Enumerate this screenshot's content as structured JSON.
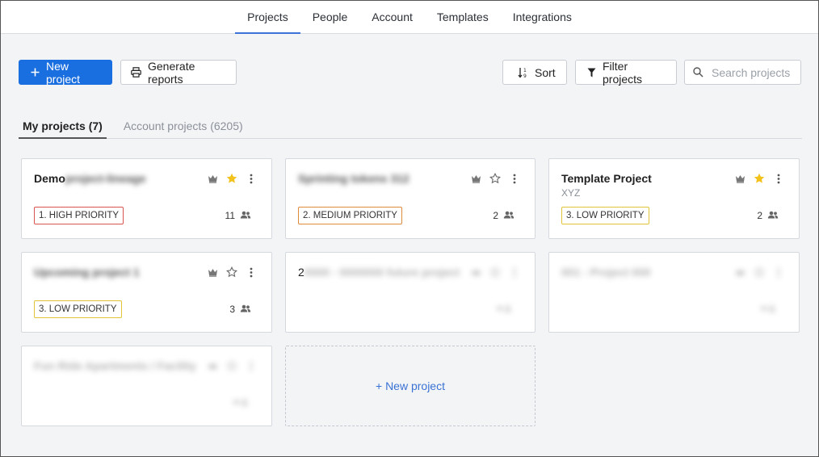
{
  "nav": {
    "items": [
      {
        "label": "Projects",
        "active": true
      },
      {
        "label": "People",
        "active": false
      },
      {
        "label": "Account",
        "active": false
      },
      {
        "label": "Templates",
        "active": false
      },
      {
        "label": "Integrations",
        "active": false
      }
    ]
  },
  "toolbar": {
    "new_project_label": "New project",
    "generate_reports_label": "Generate reports",
    "sort_label": "Sort",
    "filter_label": "Filter projects",
    "search_placeholder": "Search projects"
  },
  "tabs": {
    "my_projects": "My projects (7)",
    "account_projects": "Account projects (6205)"
  },
  "colors": {
    "primary": "#1a6fe0",
    "accent_link": "#3a72d4",
    "star_active": "#f2c21b",
    "high_priority": "#d9534f",
    "medium_priority": "#e08a3c",
    "low_priority": "#e2c43a"
  },
  "icons": [
    "plus-icon",
    "printer-icon",
    "sort-icon",
    "filter-icon",
    "search-icon",
    "crown-icon",
    "star-icon",
    "more-vert-icon",
    "people-icon"
  ],
  "cards": [
    {
      "title": "Demo",
      "title_redacted": "project-lineage",
      "subtitle": "",
      "starred": true,
      "priority": "1. HIGH PRIORITY",
      "priority_level": "high",
      "members": "11"
    },
    {
      "title": "",
      "title_redacted": "Sprinting tokens 312",
      "subtitle": "",
      "starred": false,
      "priority": "2. MEDIUM PRIORITY",
      "priority_level": "medium",
      "members": "2"
    },
    {
      "title": "Template Project",
      "title_redacted": "",
      "subtitle": "XYZ",
      "starred": true,
      "priority": "3. LOW PRIORITY",
      "priority_level": "low",
      "members": "2"
    },
    {
      "title": "",
      "title_redacted": "Upcoming project 1",
      "subtitle": "",
      "starred": false,
      "priority": "3. LOW PRIORITY",
      "priority_level": "low",
      "members": "3"
    },
    {
      "title": "2",
      "title_redacted": "0000 - 0000000 future project",
      "subtitle": "",
      "starred": false,
      "priority": "",
      "priority_level": "",
      "members": ""
    },
    {
      "title": "",
      "title_redacted": "001 - Project 000",
      "subtitle": "",
      "starred": false,
      "priority": "",
      "priority_level": "",
      "members": ""
    },
    {
      "title": "",
      "title_redacted": "Fun Ride Apartments / Facility",
      "subtitle": "",
      "starred": false,
      "priority": "",
      "priority_level": "",
      "members": ""
    }
  ],
  "new_project_card_label": "+ New project"
}
